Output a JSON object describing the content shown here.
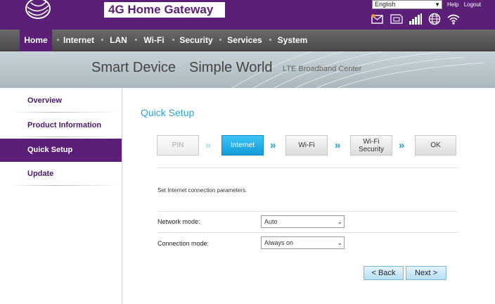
{
  "header": {
    "title": "4G Home Gateway",
    "language": "English",
    "links": [
      "Help",
      "Logout"
    ],
    "status_icons": [
      "sms-icon",
      "sim-icon",
      "signal-icon",
      "globe-icon",
      "wifi-icon"
    ],
    "brand_color": "#5c1f78"
  },
  "nav": {
    "items": [
      "Home",
      "Internet",
      "LAN",
      "Wi-Fi",
      "Security",
      "Services",
      "System"
    ],
    "active": "Home"
  },
  "banner": {
    "slogan_part1": "Smart Device",
    "slogan_part2": "Simple World",
    "tagline": "LTE  Broadband  Center"
  },
  "sidebar": {
    "items": [
      "Overview",
      "Product Information",
      "Quick Setup",
      "Update"
    ],
    "active": "Quick Setup"
  },
  "main": {
    "title": "Quick Setup",
    "steps": [
      "PIN",
      "Internet",
      "Wi-Fi",
      "Wi-Fi\nSecurity",
      "OK"
    ],
    "current_step": "Internet",
    "description": "Set Internet connection parameters.",
    "network_mode": {
      "label": "Network mode:",
      "value": "Auto"
    },
    "connection_mode": {
      "label": "Connection mode:",
      "value": "Always on"
    },
    "back_label": "< Back",
    "next_label": "Next >",
    "accent_color": "#2aa6d6"
  }
}
